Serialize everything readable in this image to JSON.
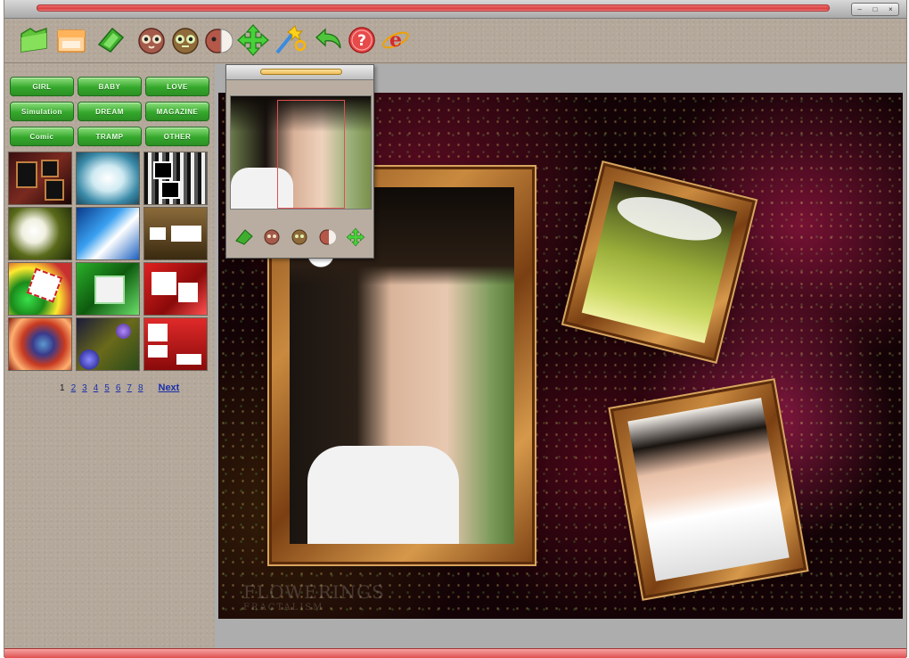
{
  "window": {
    "controls": [
      "–",
      "□",
      "×"
    ]
  },
  "toolbar": {
    "buttons": [
      {
        "name": "open-folder-button",
        "icon": "folder-icon"
      },
      {
        "name": "save-button",
        "icon": "save-box-icon"
      },
      {
        "name": "open-file-button",
        "icon": "green-file-icon"
      },
      {
        "name": "face-tool-1-button",
        "icon": "owl-face-icon"
      },
      {
        "name": "face-tool-2-button",
        "icon": "owl-face-icon"
      },
      {
        "name": "face-tool-3-button",
        "icon": "half-face-icon"
      },
      {
        "name": "move-button",
        "icon": "move-arrows-icon"
      },
      {
        "name": "effects-button",
        "icon": "magic-wand-icon"
      },
      {
        "name": "undo-button",
        "icon": "undo-arrow-icon"
      },
      {
        "name": "help-button",
        "icon": "help-icon"
      },
      {
        "name": "web-button",
        "icon": "browser-e-icon"
      }
    ]
  },
  "categories": [
    {
      "label": "GIRL"
    },
    {
      "label": "BABY"
    },
    {
      "label": "LOVE"
    },
    {
      "label": "Simulation"
    },
    {
      "label": "DREAM"
    },
    {
      "label": "MAGAZINE"
    },
    {
      "label": "Comic"
    },
    {
      "label": "TRAMP"
    },
    {
      "label": "OTHER"
    }
  ],
  "pager": {
    "pages": [
      "1",
      "2",
      "3",
      "4",
      "5",
      "6",
      "7",
      "8"
    ],
    "current": "1",
    "next_label": "Next"
  },
  "canvas": {
    "watermark_line1": "FLOWERINGS",
    "watermark_line2": "FRACTALISM"
  },
  "colors": {
    "panel": "#b4a89b",
    "accent_green": "#35a82c",
    "title_red": "#d94040",
    "canvas_gray": "#adadad"
  }
}
